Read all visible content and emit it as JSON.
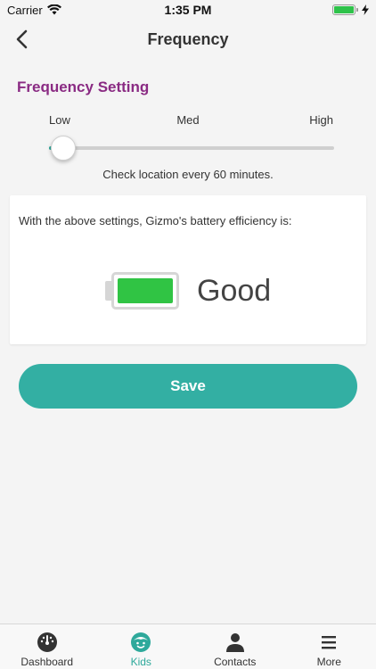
{
  "status_bar": {
    "carrier": "Carrier",
    "time": "1:35 PM"
  },
  "nav": {
    "title": "Frequency"
  },
  "frequency": {
    "section_title": "Frequency Setting",
    "labels": {
      "low": "Low",
      "med": "Med",
      "high": "High"
    },
    "slider_value": 0.05,
    "caption": "Check location every 60 minutes."
  },
  "battery_card": {
    "description": "With the above settings, Gizmo's battery efficiency is:",
    "status": "Good",
    "status_color": "#30c444"
  },
  "save_label": "Save",
  "colors": {
    "accent": "#33afa3",
    "title": "#8a2b83"
  },
  "tabs": [
    {
      "label": "Dashboard",
      "icon": "dashboard-icon",
      "active": false
    },
    {
      "label": "Kids",
      "icon": "kid-face-icon",
      "active": true
    },
    {
      "label": "Contacts",
      "icon": "person-icon",
      "active": false
    },
    {
      "label": "More",
      "icon": "menu-icon",
      "active": false
    }
  ]
}
